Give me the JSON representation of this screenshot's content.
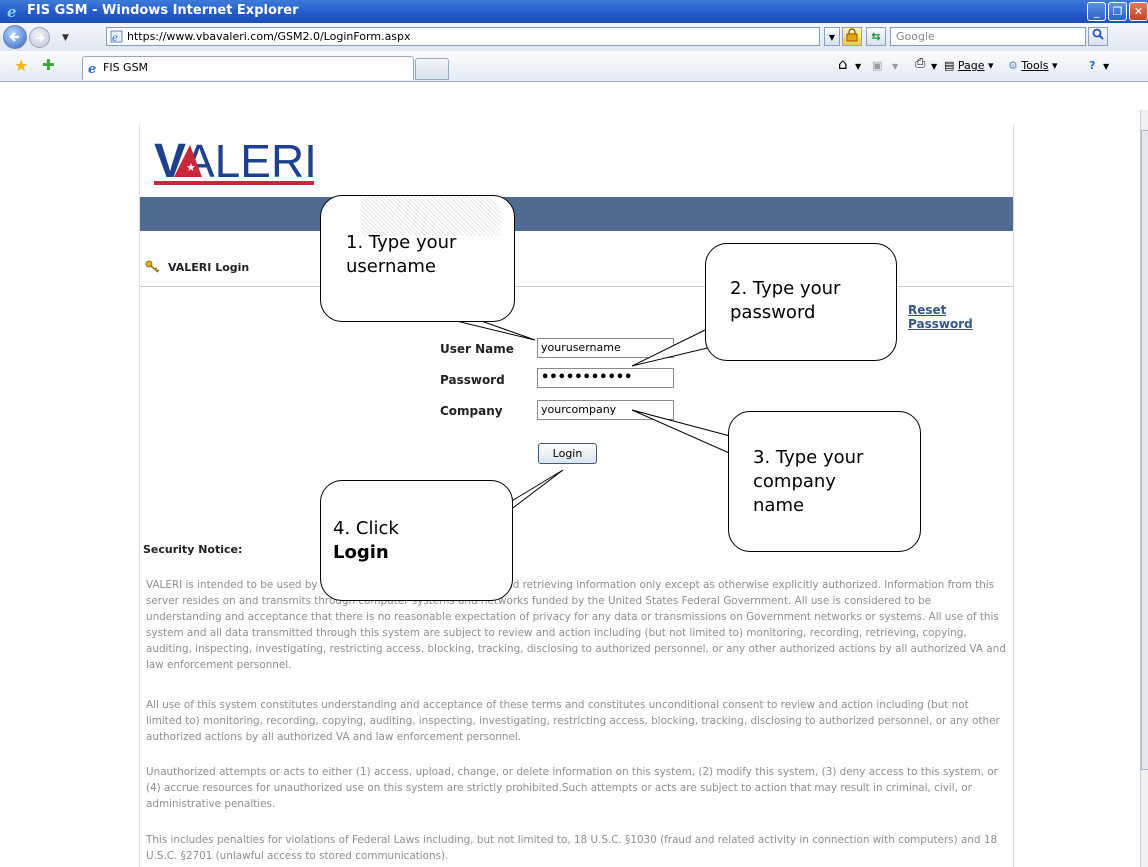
{
  "window": {
    "title": "FIS GSM - Windows Internet Explorer"
  },
  "address_bar": {
    "url": "https://www.vbavaleri.com/GSM2.0/LoginForm.aspx",
    "search_placeholder": "Google"
  },
  "tabs": [
    {
      "label": "FIS GSM"
    }
  ],
  "command_bar": {
    "page_label": "Page",
    "tools_label": "Tools"
  },
  "site": {
    "logo_text": "VALERI",
    "login_header": "VALERI Login",
    "reset_password": "Reset Password"
  },
  "form": {
    "username_label": "User Name",
    "username_value": "yourusername",
    "password_label": "Password",
    "password_value": "•••••••••••",
    "company_label": "Company",
    "company_value": "yourcompany",
    "login_button": "Login"
  },
  "security": {
    "title": "Security Notice:",
    "paragraphs": [
      "VALERI is intended to be used by authorized individuals for viewing and retrieving information only except as otherwise explicitly authorized. Information from this server resides on and transmits through computer systems and networks funded by the United States Federal Government. All use is considered to be understanding and acceptance that there is no reasonable expectation of privacy for any data or transmissions on Government networks or systems. All use of this system and all data transmitted through this system are subject to review and action including (but not limited to) monitoring, recording, retrieving, copying, auditing, inspecting, investigating, restricting access, blocking, tracking, disclosing to authorized personnel, or any other authorized actions by all authorized VA and law enforcement personnel.",
      "All use of this system constitutes understanding and acceptance of these terms and constitutes unconditional consent to review and action including (but not limited to) monitoring, recording, copying, auditing, inspecting, investigating, restricting access, blocking, tracking, disclosing to authorized personnel, or any other authorized actions by all authorized VA and law enforcement personnel.",
      "Unauthorized attempts or acts to either (1) access, upload, change, or delete information on this system, (2) modify this system, (3) deny access to this system, or (4) accrue resources for unauthorized use on this system are strictly prohibited.Such attempts or acts are subject to action that may result in criminal, civil, or administrative penalties.",
      "This includes penalties for violations of Federal Laws including, but not limited to, 18 U.S.C. §1030 (fraud and related activity in connection with computers) and 18 U.S.C. §2701 (unlawful access to stored communications)."
    ]
  },
  "callouts": {
    "step1_line1": "1. Type your",
    "step1_line2": "username",
    "step2_line1": "2. Type your",
    "step2_line2": "password",
    "step3_line1": "3. Type your",
    "step3_line2": "company",
    "step3_line3": "name",
    "step4_line1": "4. Click",
    "step4_line2": "Login"
  },
  "colors": {
    "banner": "#4e6c91",
    "logo_blue": "#1f3f8f",
    "logo_red": "#c8283a",
    "link": "#33568a"
  }
}
